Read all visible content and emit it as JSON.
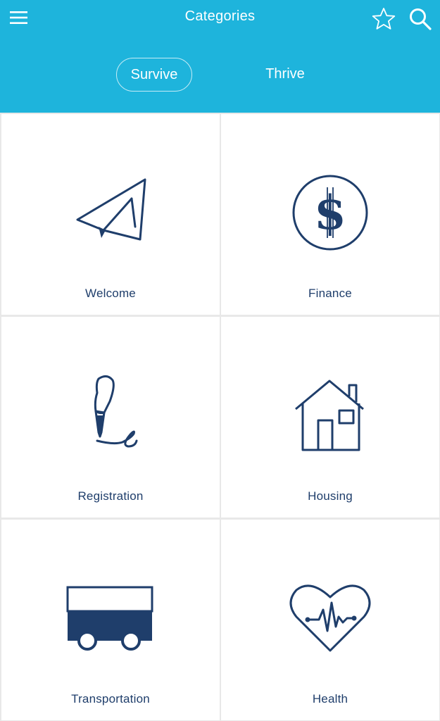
{
  "header": {
    "title": "Categories",
    "menu_icon": "hamburger-menu-icon",
    "favorites_icon": "star-icon",
    "search_icon": "search-icon"
  },
  "tabs": [
    {
      "label": "Survive",
      "active": true
    },
    {
      "label": "Thrive",
      "active": false
    }
  ],
  "categories": [
    {
      "label": "Welcome",
      "icon": "paper-plane-icon"
    },
    {
      "label": "Finance",
      "icon": "dollar-coin-icon"
    },
    {
      "label": "Registration",
      "icon": "fountain-pen-icon"
    },
    {
      "label": "Housing",
      "icon": "house-icon"
    },
    {
      "label": "Transportation",
      "icon": "bus-icon"
    },
    {
      "label": "Health",
      "icon": "heart-pulse-icon"
    }
  ],
  "colors": {
    "header_bg": "#1eb4dc",
    "icon_navy": "#1f3e6b",
    "grid_line": "#e8e8e8"
  }
}
